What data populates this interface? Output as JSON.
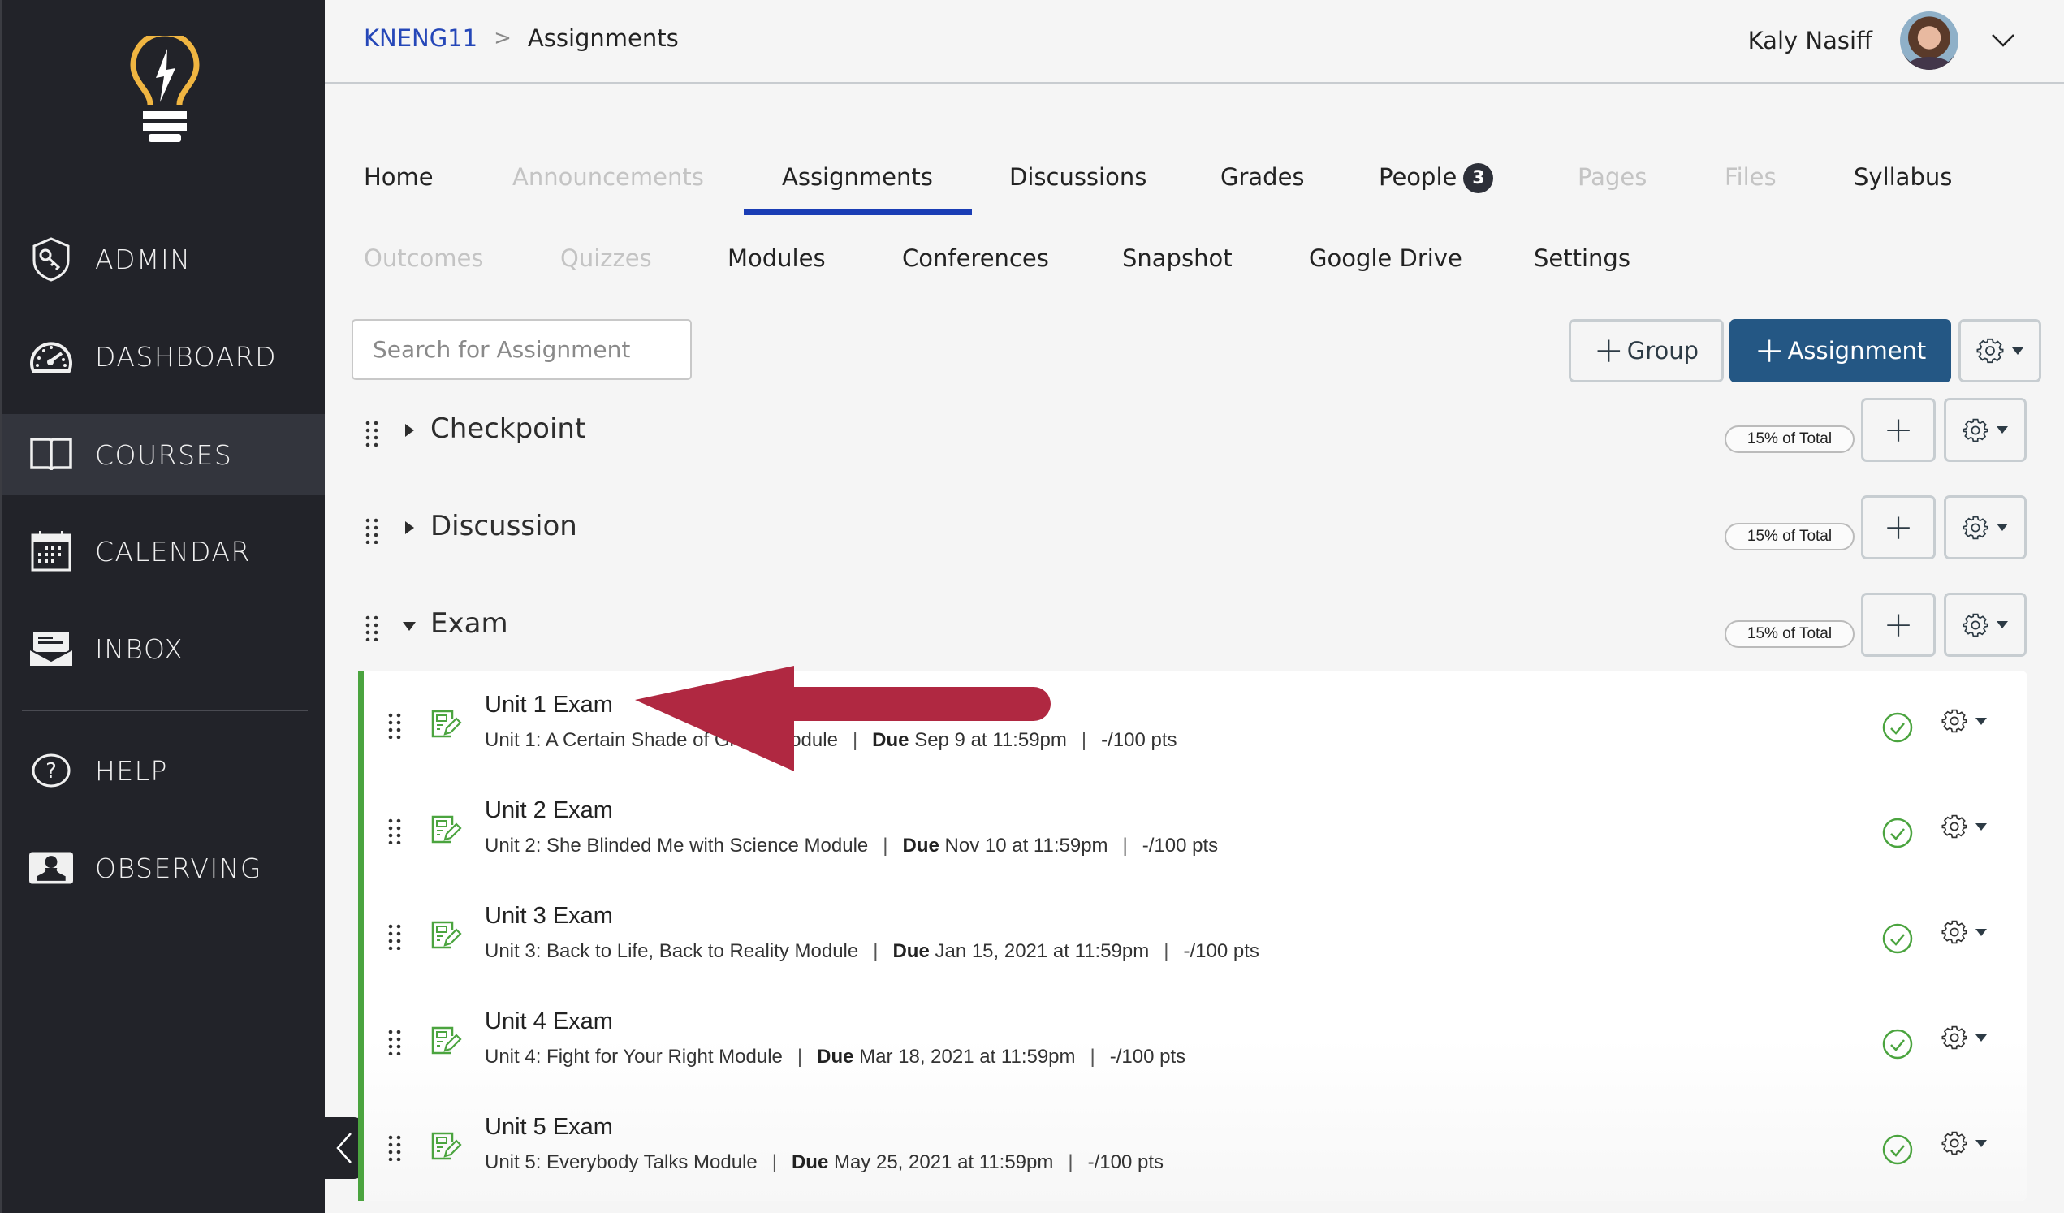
{
  "sidebar": {
    "logo": "lightbulb-logo",
    "items": [
      {
        "label": "ADMIN",
        "icon": "shield-key-icon",
        "active": false
      },
      {
        "label": "DASHBOARD",
        "icon": "speedometer-icon",
        "active": false
      },
      {
        "label": "COURSES",
        "icon": "book-icon",
        "active": true
      },
      {
        "label": "CALENDAR",
        "icon": "calendar-icon",
        "active": false
      },
      {
        "label": "INBOX",
        "icon": "envelope-icon",
        "active": false
      },
      {
        "label": "HELP",
        "icon": "question-circle-icon",
        "active": false
      },
      {
        "label": "OBSERVING",
        "icon": "person-icon",
        "active": false
      }
    ],
    "collapse_icon": "chevron-left-icon"
  },
  "header": {
    "breadcrumb": {
      "course": "KNENG11",
      "separator": ">",
      "current": "Assignments"
    },
    "user": {
      "name": "Kaly Nasiff",
      "menu_icon": "chevron-down-icon"
    }
  },
  "course_nav": {
    "row1": [
      {
        "label": "Home",
        "enabled": true
      },
      {
        "label": "Announcements",
        "enabled": false
      },
      {
        "label": "Assignments",
        "enabled": true,
        "active": true
      },
      {
        "label": "Discussions",
        "enabled": true
      },
      {
        "label": "Grades",
        "enabled": true
      },
      {
        "label": "People",
        "enabled": true,
        "badge": "3"
      },
      {
        "label": "Pages",
        "enabled": false
      },
      {
        "label": "Files",
        "enabled": false
      },
      {
        "label": "Syllabus",
        "enabled": true
      }
    ],
    "row2": [
      {
        "label": "Outcomes",
        "enabled": false
      },
      {
        "label": "Quizzes",
        "enabled": false
      },
      {
        "label": "Modules",
        "enabled": true
      },
      {
        "label": "Conferences",
        "enabled": true
      },
      {
        "label": "Snapshot",
        "enabled": true
      },
      {
        "label": "Google Drive",
        "enabled": true
      },
      {
        "label": "Settings",
        "enabled": true
      }
    ]
  },
  "toolbar": {
    "search_placeholder": "Search for Assignment",
    "search_value": "",
    "add_group_label": "Group",
    "add_assignment_label": "Assignment",
    "settings_icon": "gear-icon"
  },
  "groups": [
    {
      "name": "Checkpoint",
      "expanded": false,
      "weight": "15% of Total"
    },
    {
      "name": "Discussion",
      "expanded": false,
      "weight": "15% of Total"
    },
    {
      "name": "Exam",
      "expanded": true,
      "weight": "15% of Total"
    }
  ],
  "exam_assignments": [
    {
      "title": "Unit 1 Exam",
      "module": "Unit 1: A Certain Shade of Green Module",
      "due_label": "Due",
      "due": "Sep 9 at 11:59pm",
      "points": "-/100 pts",
      "published": true
    },
    {
      "title": "Unit 2 Exam",
      "module": "Unit 2: She Blinded Me with Science Module",
      "due_label": "Due",
      "due": "Nov 10 at 11:59pm",
      "points": "-/100 pts",
      "published": true
    },
    {
      "title": "Unit 3 Exam",
      "module": "Unit 3: Back to Life, Back to Reality Module",
      "due_label": "Due",
      "due": "Jan 15, 2021 at 11:59pm",
      "points": "-/100 pts",
      "published": true
    },
    {
      "title": "Unit 4 Exam",
      "module": "Unit 4: Fight for Your Right Module",
      "due_label": "Due",
      "due": "Mar 18, 2021 at 11:59pm",
      "points": "-/100 pts",
      "published": true
    },
    {
      "title": "Unit 5 Exam",
      "module": "Unit 5: Everybody Talks Module",
      "due_label": "Due",
      "due": "May 25, 2021 at 11:59pm",
      "points": "-/100 pts",
      "published": true
    }
  ],
  "annotation": {
    "type": "arrow",
    "color": "#b02841",
    "points_to": "Unit 1 Exam"
  },
  "colors": {
    "sidebar_bg": "#222329",
    "accent_blue": "#245784",
    "active_tab": "#1a3db5",
    "published_green": "#4ba43f",
    "logo_yellow": "#f0b541"
  }
}
